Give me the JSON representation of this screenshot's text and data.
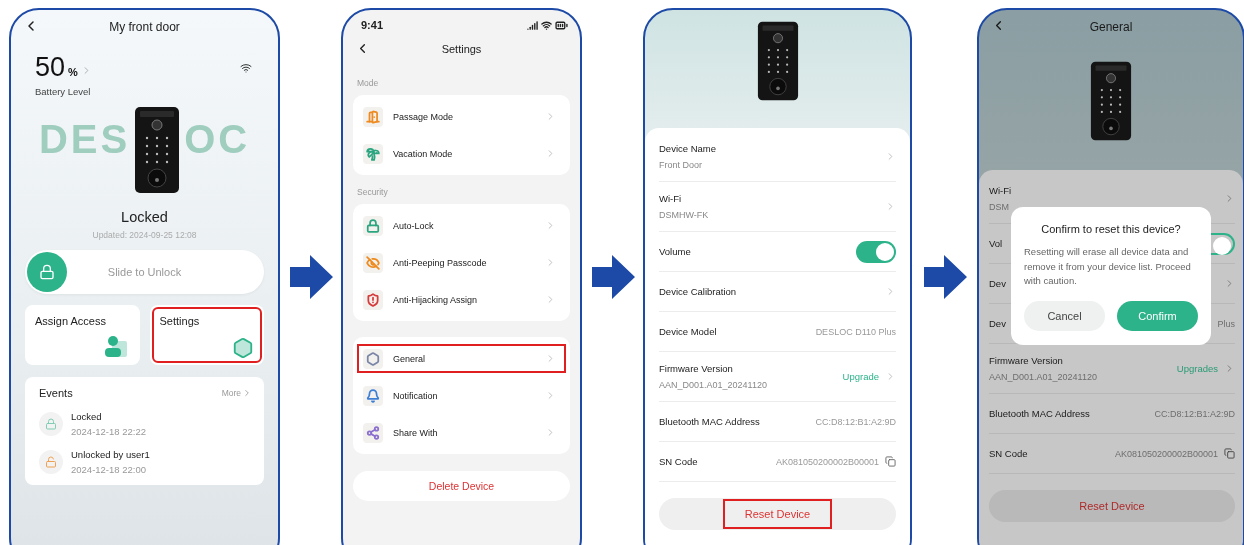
{
  "screens": [
    {
      "kind": "home",
      "title": "My front door",
      "battery": "50",
      "battery_unit": "%",
      "battery_label": "Battery Level",
      "watermark_left": "DES",
      "watermark_right": "OC",
      "lock_status": "Locked",
      "updated": "Updated: 2024-09-25 12:08",
      "slider_label": "Slide to Unlock",
      "slider": {
        "level": 0
      },
      "tiles": [
        {
          "label": "Assign Access",
          "highlighted": false
        },
        {
          "label": "Settings",
          "highlighted": true
        }
      ],
      "events_title": "Events",
      "events_more": "More",
      "events": [
        {
          "kind": "locked",
          "title": "Locked",
          "time": "2024-12-18 22:22"
        },
        {
          "kind": "unlocked",
          "title": "Unlocked by user1",
          "time": "2024-12-18 22:00"
        }
      ]
    },
    {
      "kind": "settings",
      "status_time": "9:41",
      "title": "Settings",
      "groups": [
        {
          "heading": "Mode",
          "items": [
            {
              "label": "Passage Mode",
              "color": "#ee8a1e",
              "highlighted": false
            },
            {
              "label": "Vacation Mode",
              "color": "#2aa57f",
              "highlighted": false
            }
          ]
        },
        {
          "heading": "Security",
          "items": [
            {
              "label": "Auto-Lock",
              "color": "#2aa57f",
              "highlighted": false
            },
            {
              "label": "Anti-Peeping Passcode",
              "color": "#ee8a1e",
              "highlighted": false
            },
            {
              "label": "Anti-Hijacking Assign",
              "color": "#d63a3a",
              "highlighted": false
            }
          ]
        },
        {
          "items": [
            {
              "label": "General",
              "color": "#7a86a8",
              "highlighted": true
            },
            {
              "label": "Notification",
              "color": "#3d7fd6",
              "highlighted": false
            },
            {
              "label": "Share With",
              "color": "#8a6fcf",
              "highlighted": false
            }
          ]
        }
      ],
      "delete_label": "Delete Device"
    },
    {
      "kind": "general",
      "dimmed": false,
      "rows": [
        {
          "kind": "link",
          "label": "Device Name",
          "value": "Front Door"
        },
        {
          "kind": "link",
          "label": "Wi-Fi",
          "value": "DSMHW-FK"
        },
        {
          "kind": "toggle",
          "label": "Volume",
          "on": true
        },
        {
          "kind": "link",
          "label": "Device Calibration"
        },
        {
          "kind": "info",
          "label": "Device Model",
          "value": "DESLOC D110 Plus"
        },
        {
          "kind": "firmware",
          "label": "Firmware Version",
          "value": "AAN_D001.A01_20241120",
          "action": "Upgrade"
        },
        {
          "kind": "info",
          "label": "Bluetooth MAC Address",
          "value": "CC:D8:12:B1:A2:9D"
        },
        {
          "kind": "copy",
          "label": "SN Code",
          "value": "AK081050200002B00001"
        }
      ],
      "reset_label": "Reset Device",
      "reset_highlighted": true
    },
    {
      "kind": "general",
      "dimmed": true,
      "title": "General",
      "rows": [
        {
          "kind": "link",
          "label": "Wi-Fi",
          "value": "DSM"
        },
        {
          "kind": "toggle",
          "label": "Vol",
          "on": true
        },
        {
          "kind": "link",
          "label": "Dev"
        },
        {
          "kind": "info",
          "label": "Dev",
          "value": "Plus"
        },
        {
          "kind": "firmware",
          "label": "Firmware Version",
          "value": "AAN_D001.A01_20241120",
          "action": "Upgrades"
        },
        {
          "kind": "info",
          "label": "Bluetooth MAC Address",
          "value": "CC:D8:12:B1:A2:9D"
        },
        {
          "kind": "copy",
          "label": "SN Code",
          "value": "AK081050200002B00001"
        }
      ],
      "reset_label": "Reset Device",
      "reset_highlighted": false,
      "dialog": {
        "title": "Confirm to reset this device?",
        "message": "Resetting will erase all device data and remove it from your device list. Proceed with caution.",
        "cancel": "Cancel",
        "confirm": "Confirm"
      }
    }
  ]
}
